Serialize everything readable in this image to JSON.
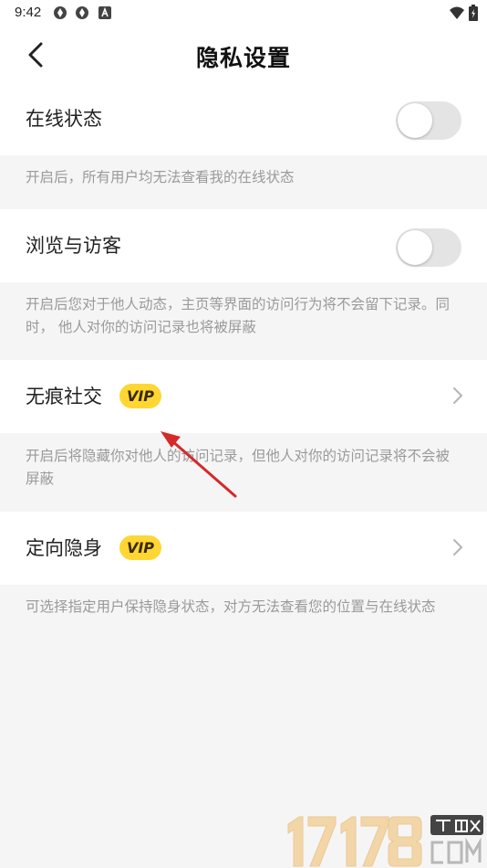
{
  "status_bar": {
    "time": "9:42"
  },
  "header": {
    "title": "隐私设置"
  },
  "settings": [
    {
      "label": "在线状态",
      "description": "开启后，所有用户均无法查看我的在线状态"
    },
    {
      "label": "浏览与访客",
      "description": "开启后您对于他人动态，主页等界面的访问行为将不会留下记录。同时， 他人对你的访问记录也将被屏蔽"
    },
    {
      "label": "无痕社交",
      "badge": "VIP",
      "description": "开启后将隐藏你对他人的访问记录，但他人对你的访问记录将不会被屏蔽"
    },
    {
      "label": "定向隐身",
      "badge": "VIP",
      "description": "可选择指定用户保持隐身状态，对方无法查看您的位置与在线状态"
    }
  ],
  "colors": {
    "accent_vip": "#ffd633",
    "annotation_arrow": "#d42a2a"
  }
}
